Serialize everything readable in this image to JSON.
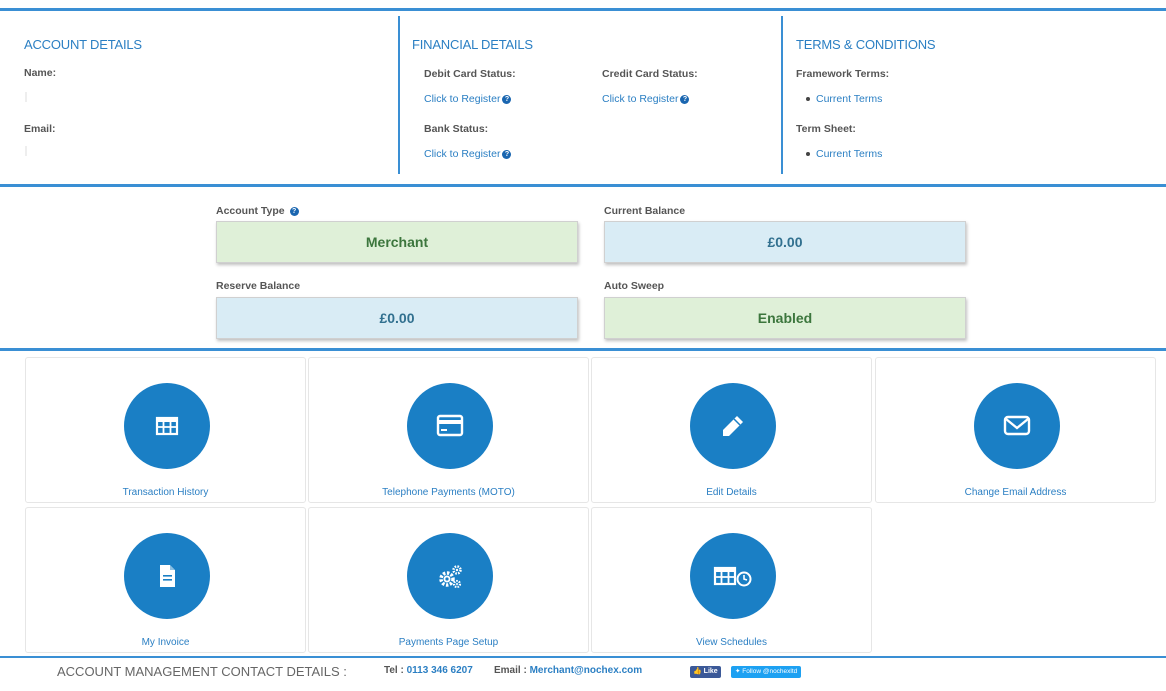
{
  "account_details": {
    "title": "ACCOUNT DETAILS",
    "name_label": "Name:",
    "email_label": "Email:"
  },
  "financial_details": {
    "title": "FINANCIAL DETAILS",
    "debit_label": "Debit Card Status:",
    "debit_link": "Click to Register",
    "credit_label": "Credit Card Status:",
    "credit_link": "Click to Register",
    "bank_label": "Bank Status:",
    "bank_link": "Click to Register"
  },
  "terms": {
    "title": "TERMS & CONDITIONS",
    "framework_label": "Framework Terms:",
    "framework_link": "Current Terms",
    "termsheet_label": "Term Sheet:",
    "termsheet_link": "Current Terms"
  },
  "summary": {
    "account_type_label": "Account Type",
    "account_type_value": "Merchant",
    "current_balance_label": "Current Balance",
    "current_balance_value": "£0.00",
    "reserve_balance_label": "Reserve Balance",
    "reserve_balance_value": "£0.00",
    "auto_sweep_label": "Auto Sweep",
    "auto_sweep_value": "Enabled"
  },
  "tiles": [
    {
      "label": "Transaction History",
      "icon": "table-icon"
    },
    {
      "label": "Telephone Payments (MOTO)",
      "icon": "credit-card-icon"
    },
    {
      "label": "Edit Details",
      "icon": "pencil-icon"
    },
    {
      "label": "Change Email Address",
      "icon": "envelope-icon"
    },
    {
      "label": "My Invoice",
      "icon": "document-icon"
    },
    {
      "label": "Payments Page Setup",
      "icon": "gears-icon"
    },
    {
      "label": "View Schedules",
      "icon": "table-clock-icon"
    }
  ],
  "footer": {
    "title": "ACCOUNT MANAGEMENT CONTACT DETAILS :",
    "tel_label": "Tel : ",
    "tel_value": "0113 346 6207",
    "email_label": "Email : ",
    "email_value": "Merchant@nochex.com",
    "like_label": "Like",
    "follow_label": "Follow @nochexltd"
  },
  "colors": {
    "accent": "#3a8fd4",
    "circle": "#1a7fc5",
    "green_box": "#dff0d8",
    "blue_box": "#d9ecf5"
  }
}
